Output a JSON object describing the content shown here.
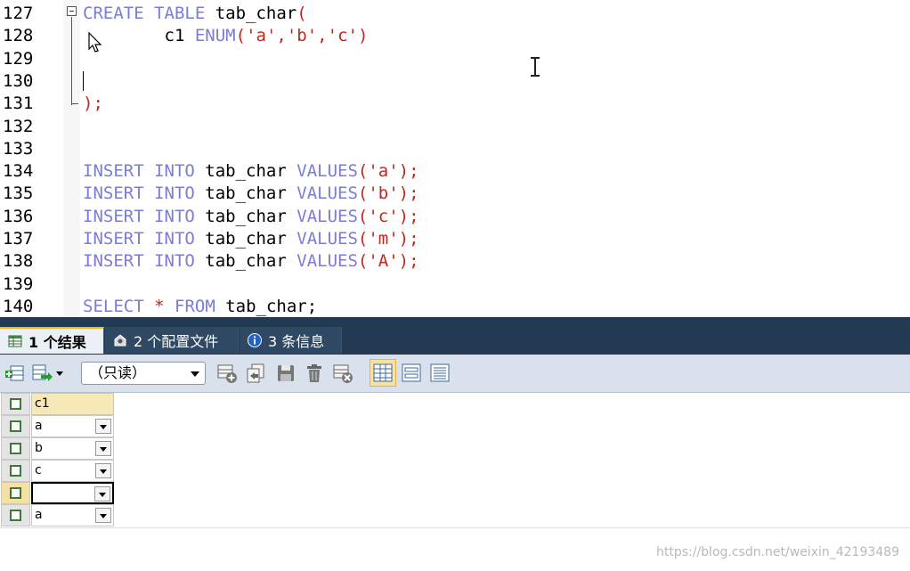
{
  "editor": {
    "lines": [
      {
        "num": "127",
        "tokens": [
          {
            "t": "CREATE",
            "c": "kw"
          },
          {
            "t": " "
          },
          {
            "t": "TABLE",
            "c": "kw"
          },
          {
            "t": " tab_char"
          },
          {
            "t": "(",
            "c": "pun"
          }
        ]
      },
      {
        "num": "128",
        "tokens": [
          {
            "t": "        c1 "
          },
          {
            "t": "ENUM",
            "c": "kw"
          },
          {
            "t": "(",
            "c": "pun"
          },
          {
            "t": "'a'",
            "c": "str"
          },
          {
            "t": ",",
            "c": "pun"
          },
          {
            "t": "'b'",
            "c": "str"
          },
          {
            "t": ",",
            "c": "pun"
          },
          {
            "t": "'c'",
            "c": "str"
          },
          {
            "t": ")",
            "c": "pun"
          }
        ]
      },
      {
        "num": "129",
        "tokens": []
      },
      {
        "num": "130",
        "tokens": []
      },
      {
        "num": "131",
        "tokens": [
          {
            "t": ");",
            "c": "pun"
          }
        ]
      },
      {
        "num": "132",
        "tokens": []
      },
      {
        "num": "133",
        "tokens": []
      },
      {
        "num": "134",
        "tokens": [
          {
            "t": "INSERT",
            "c": "kw"
          },
          {
            "t": " "
          },
          {
            "t": "INTO",
            "c": "kw"
          },
          {
            "t": " tab_char "
          },
          {
            "t": "VALUES",
            "c": "kw"
          },
          {
            "t": "(",
            "c": "pun"
          },
          {
            "t": "'a'",
            "c": "str"
          },
          {
            "t": ");",
            "c": "pun"
          }
        ]
      },
      {
        "num": "135",
        "tokens": [
          {
            "t": "INSERT",
            "c": "kw"
          },
          {
            "t": " "
          },
          {
            "t": "INTO",
            "c": "kw"
          },
          {
            "t": " tab_char "
          },
          {
            "t": "VALUES",
            "c": "kw"
          },
          {
            "t": "(",
            "c": "pun"
          },
          {
            "t": "'b'",
            "c": "str"
          },
          {
            "t": ");",
            "c": "pun"
          }
        ]
      },
      {
        "num": "136",
        "tokens": [
          {
            "t": "INSERT",
            "c": "kw"
          },
          {
            "t": " "
          },
          {
            "t": "INTO",
            "c": "kw"
          },
          {
            "t": " tab_char "
          },
          {
            "t": "VALUES",
            "c": "kw"
          },
          {
            "t": "(",
            "c": "pun"
          },
          {
            "t": "'c'",
            "c": "str"
          },
          {
            "t": ");",
            "c": "pun"
          }
        ]
      },
      {
        "num": "137",
        "tokens": [
          {
            "t": "INSERT",
            "c": "kw"
          },
          {
            "t": " "
          },
          {
            "t": "INTO",
            "c": "kw"
          },
          {
            "t": " tab_char "
          },
          {
            "t": "VALUES",
            "c": "kw"
          },
          {
            "t": "(",
            "c": "pun"
          },
          {
            "t": "'m'",
            "c": "str"
          },
          {
            "t": ");",
            "c": "pun"
          }
        ]
      },
      {
        "num": "138",
        "tokens": [
          {
            "t": "INSERT",
            "c": "kw"
          },
          {
            "t": " "
          },
          {
            "t": "INTO",
            "c": "kw"
          },
          {
            "t": " tab_char "
          },
          {
            "t": "VALUES",
            "c": "kw"
          },
          {
            "t": "(",
            "c": "pun"
          },
          {
            "t": "'A'",
            "c": "str"
          },
          {
            "t": ");",
            "c": "pun"
          }
        ]
      },
      {
        "num": "139",
        "tokens": []
      },
      {
        "num": "140",
        "tokens": [
          {
            "t": "SELECT",
            "c": "kw"
          },
          {
            "t": " "
          },
          {
            "t": "*",
            "c": "pun"
          },
          {
            "t": " "
          },
          {
            "t": "FROM",
            "c": "kw"
          },
          {
            "t": " tab_char;"
          }
        ]
      }
    ]
  },
  "tabs": [
    {
      "label": "1 个结果",
      "icon": "result-grid-icon",
      "active": true
    },
    {
      "label": "2 个配置文件",
      "icon": "profile-icon",
      "active": false
    },
    {
      "label": "3 条信息",
      "icon": "info-icon",
      "active": false
    }
  ],
  "toolbar": {
    "mode_select": "（只读）",
    "icons": [
      "insert-row-icon",
      "export-icon",
      "add-record-icon",
      "duplicate-icon",
      "save-icon",
      "delete-icon",
      "cancel-icon",
      "grid-view-icon",
      "form-view-icon",
      "text-view-icon"
    ]
  },
  "result": {
    "header": "c1",
    "rows": [
      "a",
      "b",
      "c",
      "",
      "a"
    ]
  },
  "colors": {
    "keyword": "#7b7bd9",
    "string": "#c0281d",
    "tabbar": "#243a52",
    "active_tab_accent": "#f1b71e"
  },
  "watermark": "https://blog.csdn.net/weixin_42193489"
}
